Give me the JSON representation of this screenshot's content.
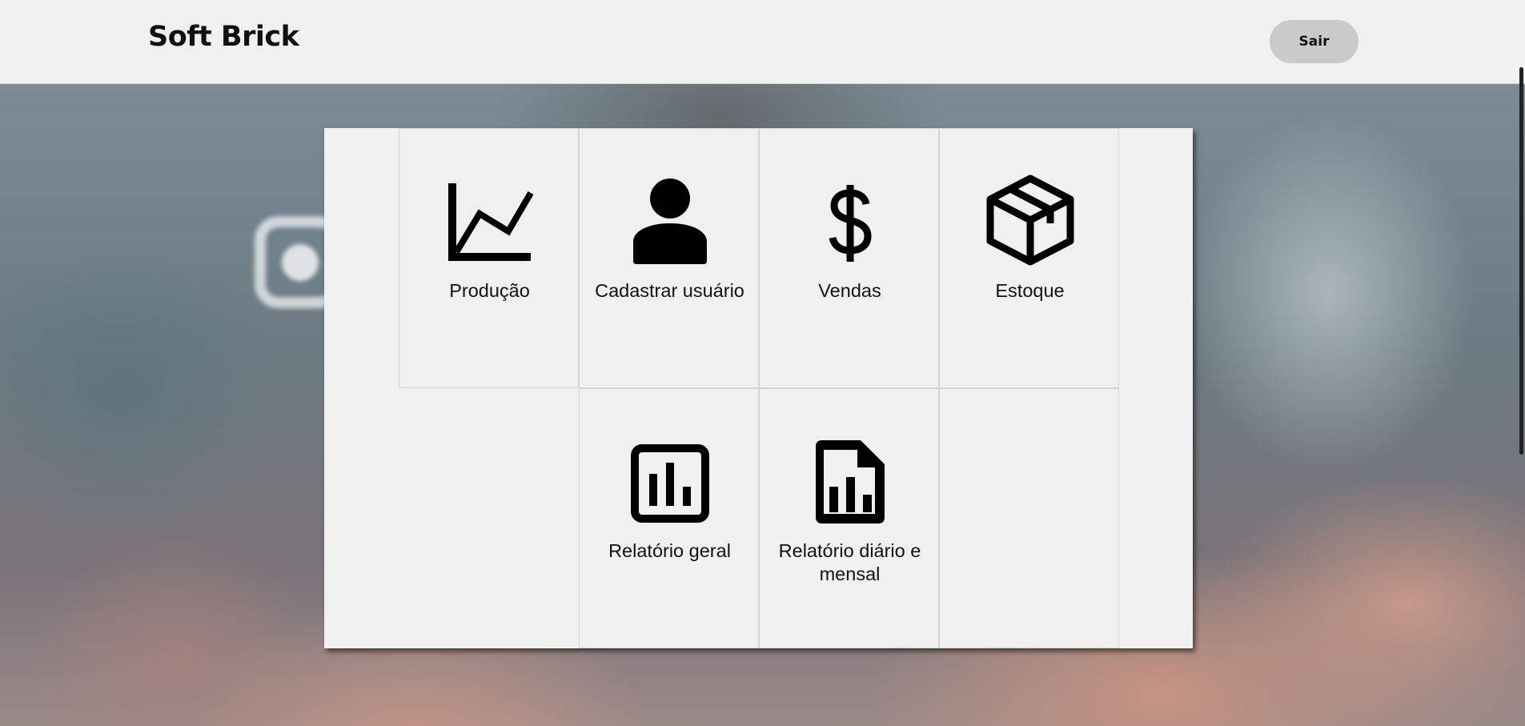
{
  "header": {
    "brand": "Soft Brick",
    "logout_label": "Sair"
  },
  "tiles": [
    {
      "label": "Produção",
      "icon": "line-chart-icon"
    },
    {
      "label": "Cadastrar usuário",
      "icon": "person-icon"
    },
    {
      "label": "Vendas",
      "icon": "dollar-icon"
    },
    {
      "label": "Estoque",
      "icon": "box-icon"
    },
    {
      "label": "Relatório geral",
      "icon": "bar-chart-icon"
    },
    {
      "label": "Relatório diário e mensal",
      "icon": "report-file-icon"
    }
  ]
}
